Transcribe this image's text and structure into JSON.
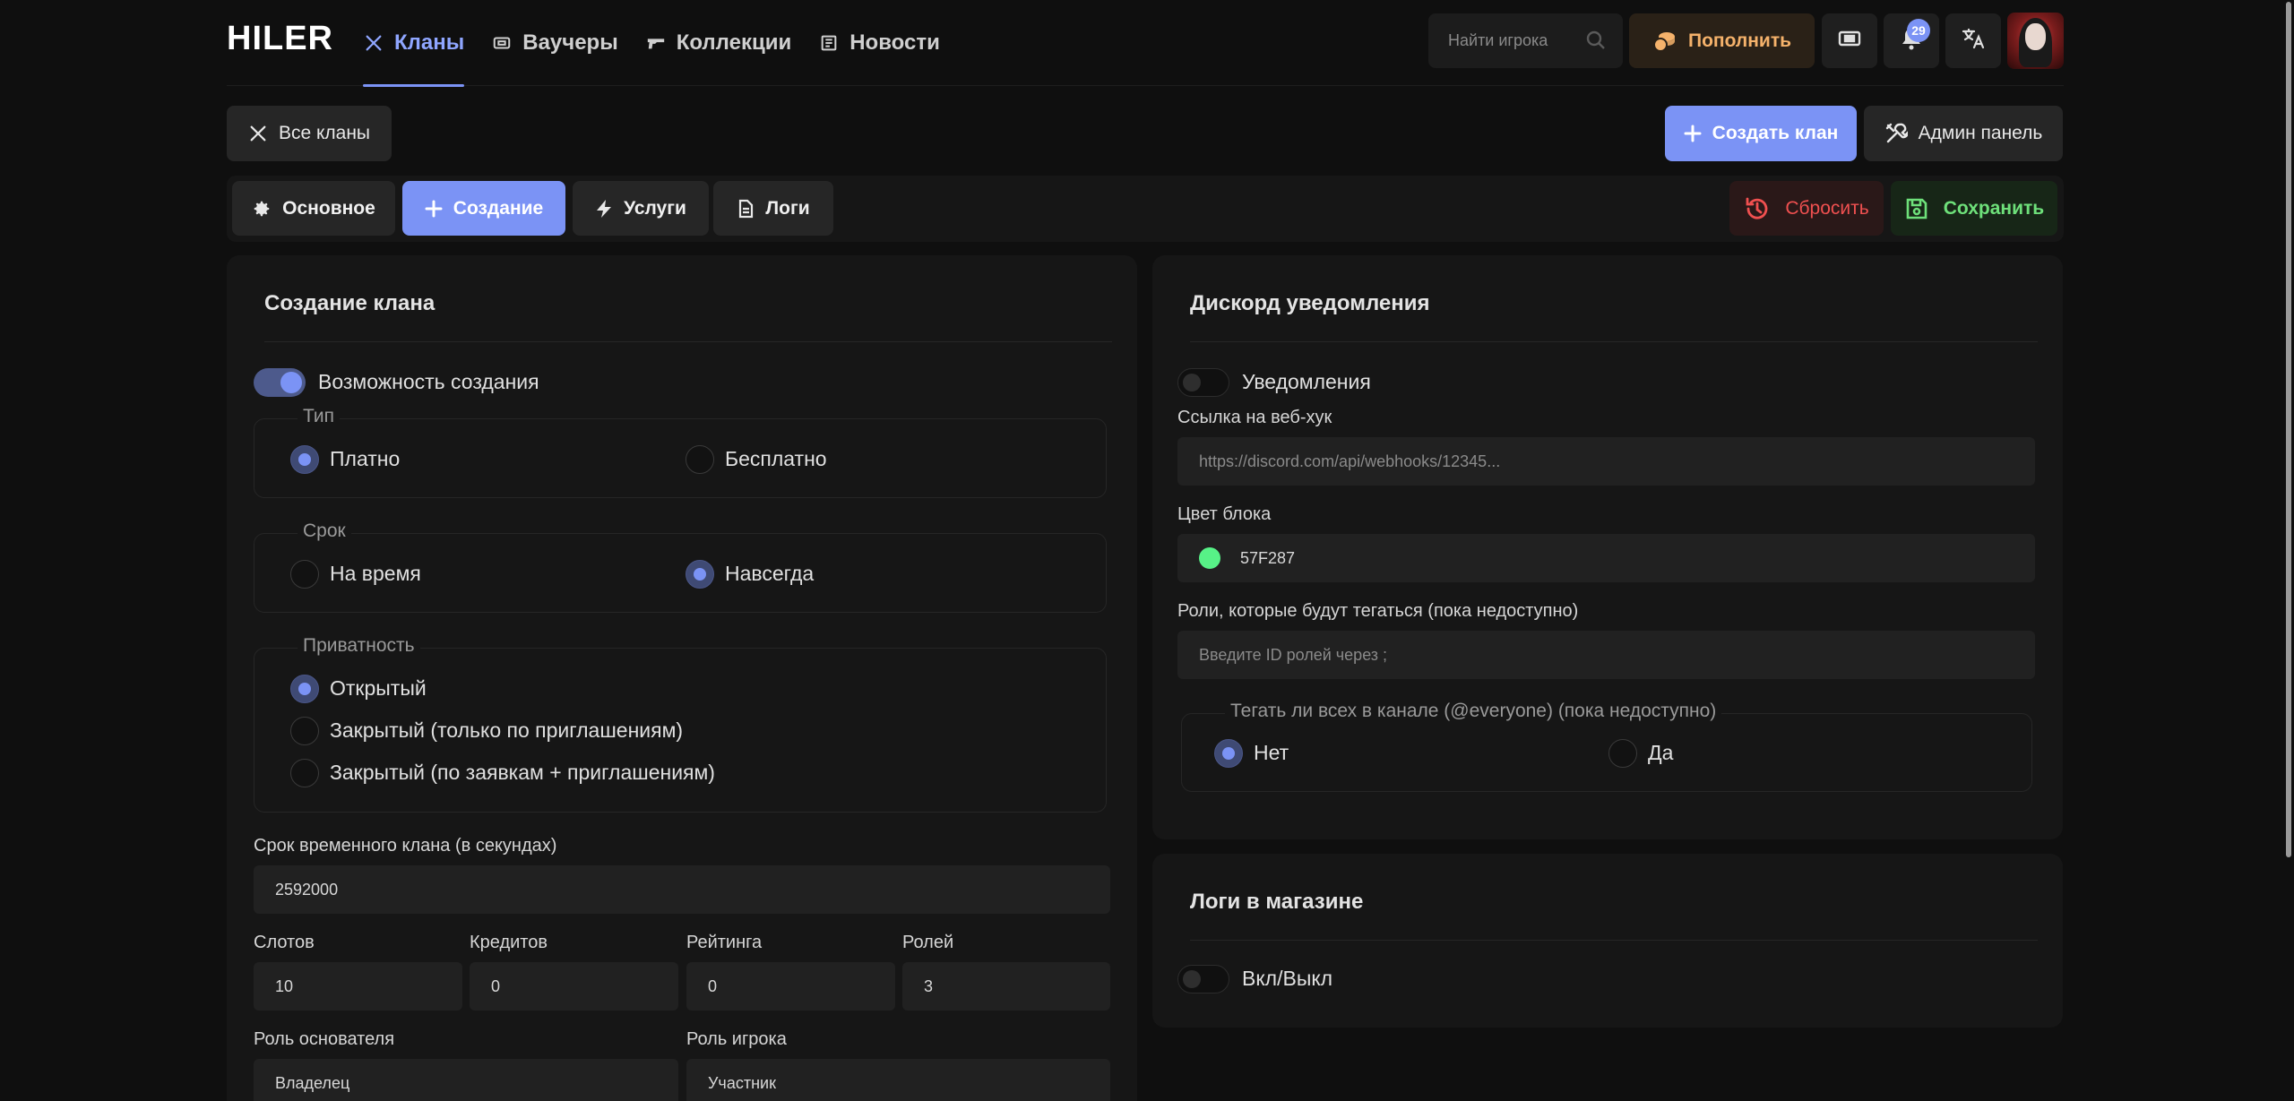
{
  "brand": "HILER",
  "nav": [
    {
      "label": "Кланы",
      "icon": "swords-icon",
      "active": true
    },
    {
      "label": "Ваучеры",
      "icon": "ticket-icon",
      "active": false
    },
    {
      "label": "Коллекции",
      "icon": "gun-icon",
      "active": false
    },
    {
      "label": "Новости",
      "icon": "newspaper-icon",
      "active": false
    }
  ],
  "search": {
    "placeholder": "Найти игрока"
  },
  "topup": {
    "label": "Пополнить"
  },
  "notifications": {
    "count": "29"
  },
  "actions": {
    "all_clans": "Все кланы",
    "create_clan": "Создать клан",
    "admin_panel": "Админ панель"
  },
  "tabs": [
    {
      "label": "Основное",
      "icon": "gear-icon"
    },
    {
      "label": "Создание",
      "icon": "plus-icon",
      "active": true
    },
    {
      "label": "Услуги",
      "icon": "bolt-icon"
    },
    {
      "label": "Логи",
      "icon": "file-icon"
    }
  ],
  "reset_label": "Сбросить",
  "save_label": "Сохранить",
  "create_panel": {
    "title": "Создание клана",
    "enable_label": "Возможность создания",
    "type": {
      "legend": "Тип",
      "options": [
        "Платно",
        "Бесплатно"
      ],
      "selected": 0
    },
    "term": {
      "legend": "Срок",
      "options": [
        "На время",
        "Навсегда"
      ],
      "selected": 1
    },
    "privacy": {
      "legend": "Приватность",
      "options": [
        "Открытый",
        "Закрытый (только по приглашениям)",
        "Закрытый (по заявкам + приглашениям)"
      ],
      "selected": 0
    },
    "duration": {
      "label": "Срок временного клана (в секундах)",
      "value": "2592000"
    },
    "slots": {
      "label": "Слотов",
      "value": "10"
    },
    "credits": {
      "label": "Кредитов",
      "value": "0"
    },
    "rating": {
      "label": "Рейтинга",
      "value": "0"
    },
    "roles": {
      "label": "Ролей",
      "value": "3"
    },
    "founder_role": {
      "label": "Роль основателя",
      "value": "Владелец"
    },
    "player_role": {
      "label": "Роль игрока",
      "value": "Участник"
    }
  },
  "discord_panel": {
    "title": "Дискорд уведомления",
    "notify_label": "Уведомления",
    "webhook": {
      "label": "Ссылка на веб-хук",
      "placeholder": "https://discord.com/api/webhooks/12345..."
    },
    "color": {
      "label": "Цвет блока",
      "value": "57F287",
      "hex": "#57F287"
    },
    "roles": {
      "label": "Роли, которые будут тегаться (пока недоступно)",
      "placeholder": "Введите ID ролей через ;"
    },
    "everyone": {
      "legend": "Тегать ли всех в канале (@everyone) (пока недоступно)",
      "options": [
        "Нет",
        "Да"
      ],
      "selected": 0
    }
  },
  "logs_panel": {
    "title": "Логи в магазине",
    "toggle_label": "Вкл/Выкл"
  },
  "colors": {
    "accent": "#7b93f5",
    "danger": "#f05050",
    "success": "#6ee07a",
    "topup": "#f5b26b"
  }
}
